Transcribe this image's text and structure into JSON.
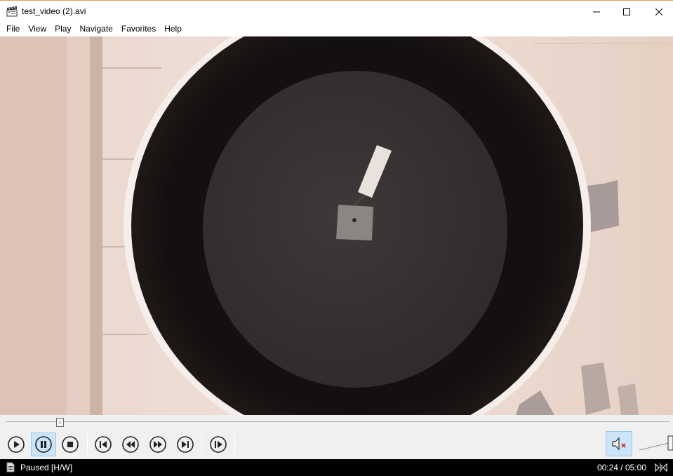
{
  "window": {
    "title": "test_video (2).avi",
    "app_icon": "film-clapper-icon",
    "controls": [
      "minimize-icon",
      "maximize-icon",
      "close-icon"
    ]
  },
  "menu": {
    "items": [
      "File",
      "View",
      "Play",
      "Navigate",
      "Favorites",
      "Help"
    ]
  },
  "seekbar": {
    "position_fraction": 0.08
  },
  "controls": {
    "buttons": [
      {
        "name": "play-button",
        "icon": "play-icon",
        "active": false
      },
      {
        "name": "pause-button",
        "icon": "pause-icon",
        "active": true
      },
      {
        "name": "stop-button",
        "icon": "stop-icon",
        "active": false
      },
      {
        "name": "previous-button",
        "icon": "skip-previous-icon",
        "active": false
      },
      {
        "name": "rewind-button",
        "icon": "rewind-icon",
        "active": false
      },
      {
        "name": "fast-forward-button",
        "icon": "fast-forward-icon",
        "active": false
      },
      {
        "name": "next-button",
        "icon": "skip-next-icon",
        "active": false
      },
      {
        "name": "frame-step-button",
        "icon": "frame-step-icon",
        "active": false
      }
    ],
    "mute": {
      "icon": "speaker-muted-icon",
      "muted": true
    }
  },
  "status": {
    "text": "Paused [H/W]",
    "time": "00:24 / 05:00"
  },
  "colors": {
    "active_button_bg": "#cce4f7",
    "active_button_border": "#99c9ef",
    "status_bar_bg": "#000000"
  }
}
